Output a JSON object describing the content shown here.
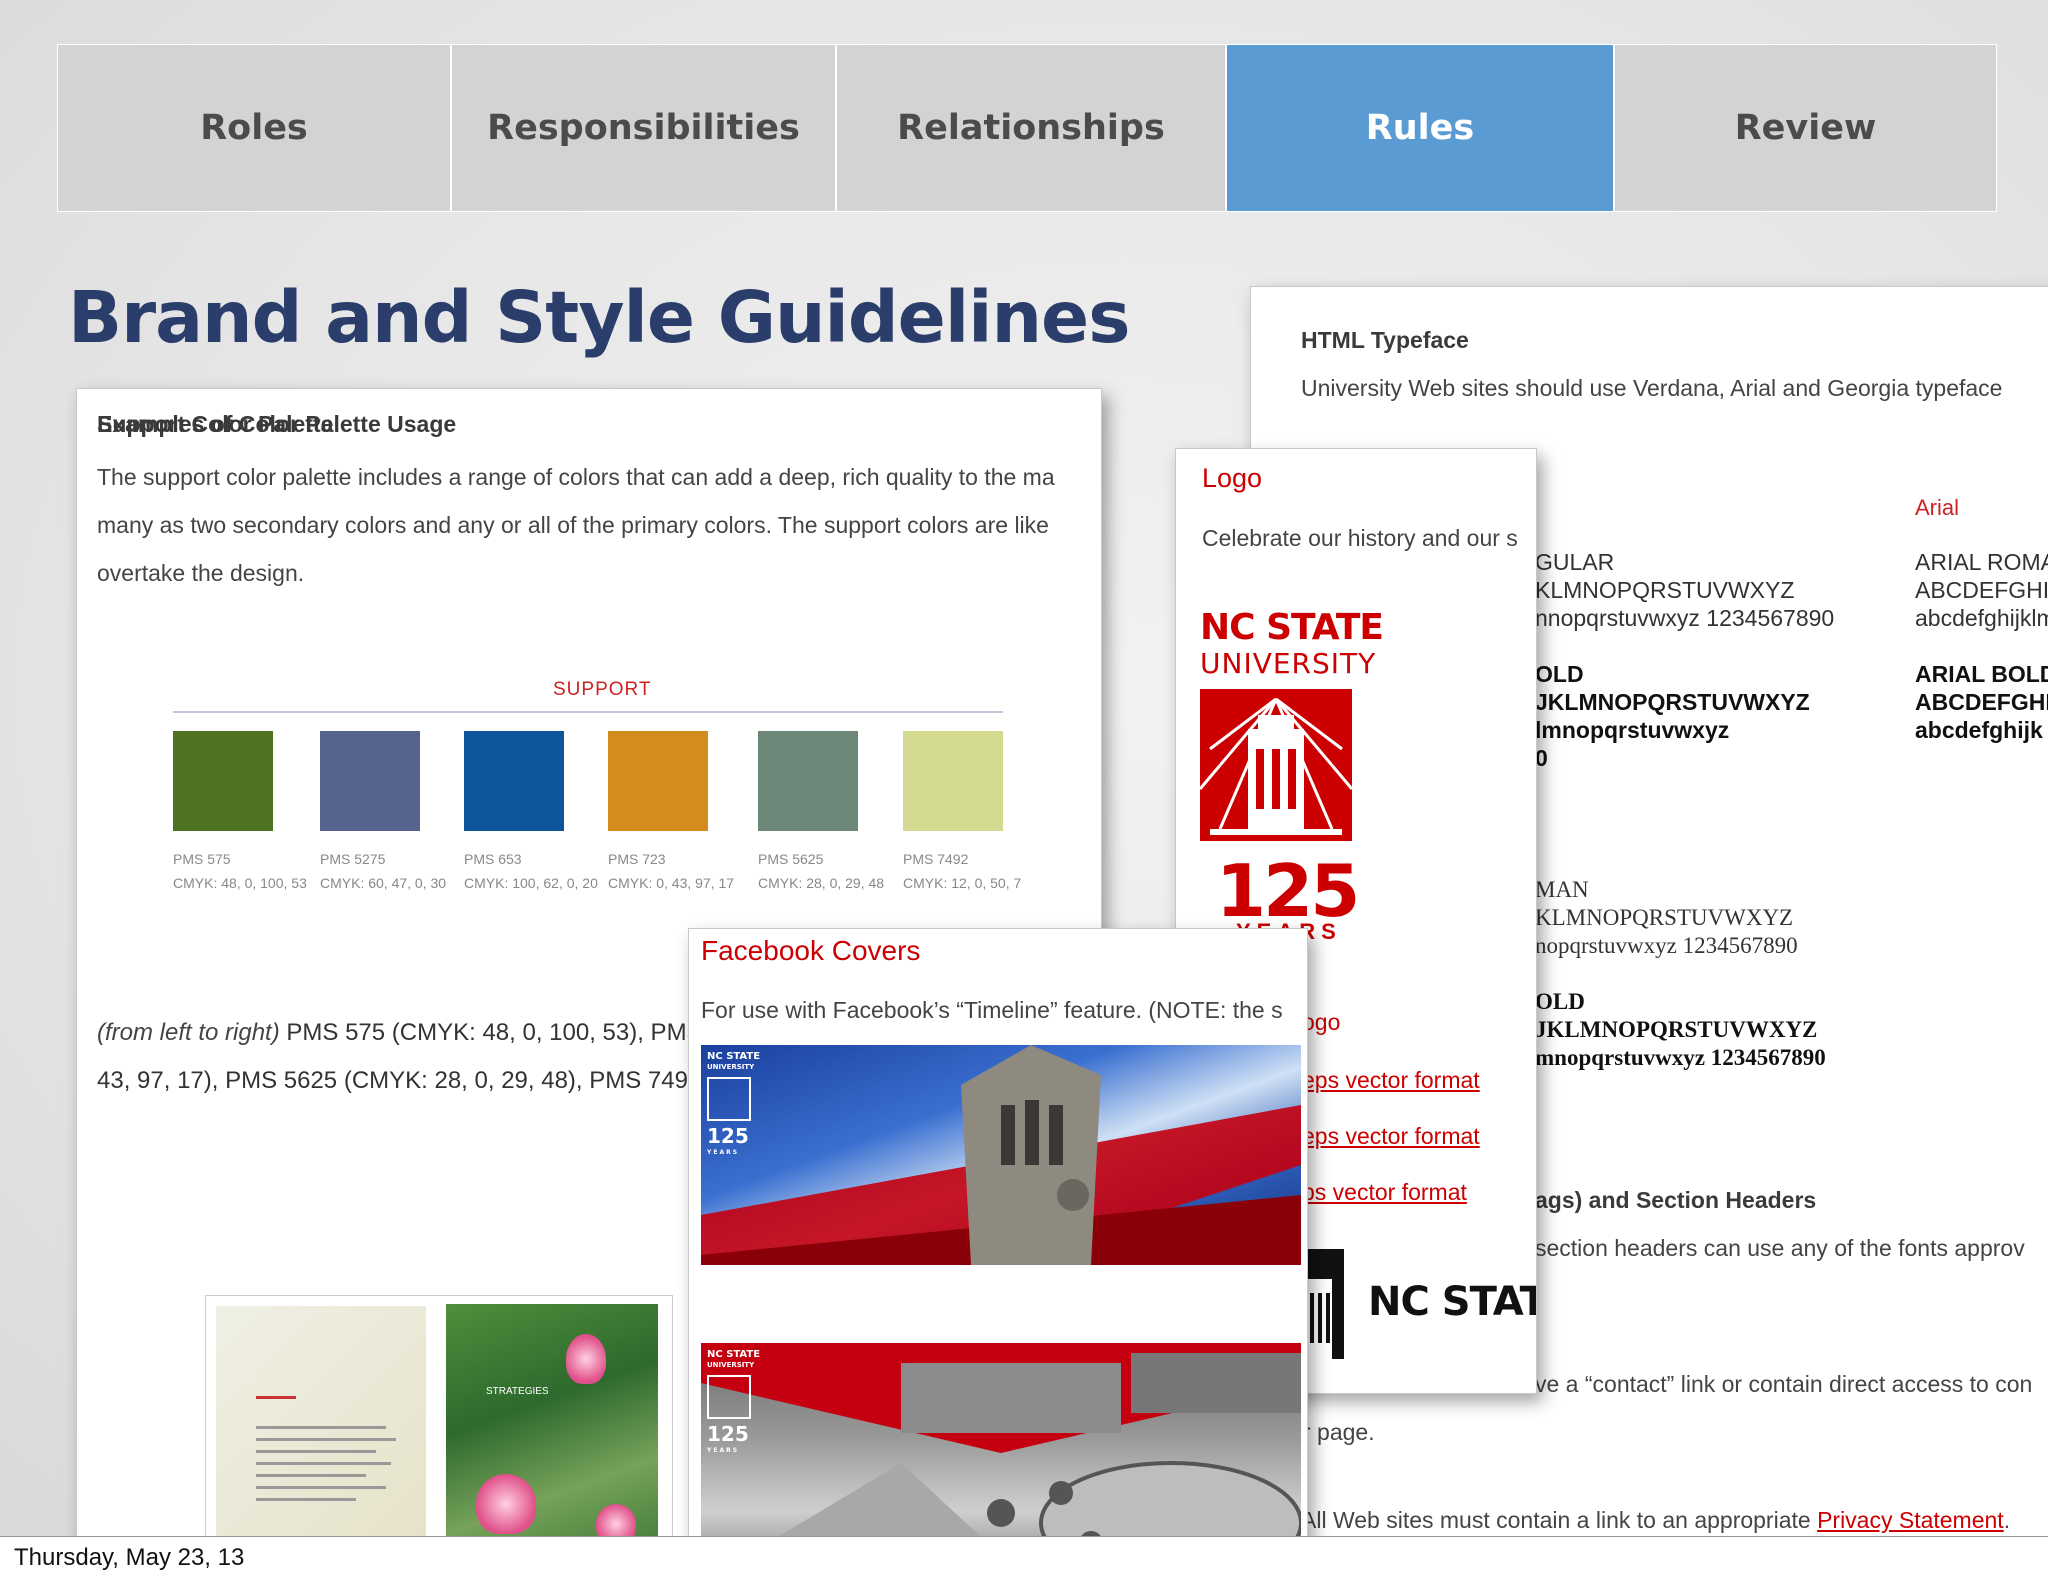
{
  "nav": {
    "tabs": [
      {
        "label": "Roles",
        "active": false
      },
      {
        "label": "Responsibilities",
        "active": false
      },
      {
        "label": "Relationships",
        "active": false
      },
      {
        "label": "Rules",
        "active": true
      },
      {
        "label": "Review",
        "active": false
      }
    ],
    "active_color": "#5a9bd3",
    "inactive_color": "#d3d3d3"
  },
  "page": {
    "title": "Brand and Style Guidelines",
    "footer_date": "Thursday, May 23, 13"
  },
  "palette_card": {
    "heading": "Support Color Palette",
    "lines": [
      "The support color palette includes a range of colors that can add a deep, rich quality to the ma",
      "many as two secondary colors and any or all of the primary colors. The support colors are like",
      "overtake the design."
    ],
    "support_label": "SUPPORT",
    "swatches": [
      {
        "name": "PMS 575",
        "cmyk": "CMYK: 48, 0, 100, 53",
        "color": "#4f7321"
      },
      {
        "name": "PMS 5275",
        "cmyk": "CMYK: 60, 47, 0, 30",
        "color": "#56638f"
      },
      {
        "name": "PMS 653",
        "cmyk": "CMYK: 100, 62, 0, 20",
        "color": "#0d5699"
      },
      {
        "name": "PMS 723",
        "cmyk": "CMYK: 0, 43, 97, 17",
        "color": "#d48c1f"
      },
      {
        "name": "PMS 5625",
        "cmyk": "CMYK: 28, 0, 29, 48",
        "color": "#6d8879"
      },
      {
        "name": "PMS 7492",
        "cmyk": "CMYK: 12, 0, 50, 7",
        "color": "#d3da8f"
      }
    ],
    "desc_italic": "(from left to right)",
    "desc_line1": " PMS 575 (CMYK: 48, 0, 100, 53), PMS",
    "desc_line2": "43, 97, 17), PMS 5625 (CMYK: 28, 0, 29, 48), PMS 749",
    "examples_heading": "Examples of Color Palette Usage",
    "example_headline": "STRATEGIES"
  },
  "type_card": {
    "heading": "HTML Typeface",
    "intro": "University Web sites should use Verdana, Arial and Georgia typeface",
    "arial_label": "Arial",
    "verdana_regular": [
      "GULAR",
      "KLMNOPQRSTUVWXYZ",
      "nnopqrstuvwxyz 1234567890"
    ],
    "verdana_bold": [
      "OLD",
      "JKLMNOPQRSTUVWXYZ",
      "lmnopqrstuvwxyz",
      "0"
    ],
    "arial_regular": [
      "ARIAL ROMA",
      "ABCDEFGHI",
      "abcdefghijklm"
    ],
    "arial_bold": [
      "ARIAL BOLD",
      "ABCDEFGHI",
      "abcdefghijk"
    ],
    "georgia_regular": [
      "MAN",
      "KLMNOPQRSTUVWXYZ",
      "nopqrstuvwxyz 1234567890"
    ],
    "georgia_bold": [
      "OLD",
      "JKLMNOPQRSTUVWXYZ",
      "mnopqrstuvwxyz 1234567890"
    ],
    "section_heading": "ags) and Section Headers",
    "section_text": "section headers can use any of the fonts approv",
    "contact_text": "ve a “contact” link or contain direct access to con",
    "page_text": "r page.",
    "privacy_prefix": "All Web sites must contain a link to an appropriate ",
    "privacy_link": "Privacy Statement",
    "privacy_suffix": "."
  },
  "logo_card": {
    "title": "Logo",
    "intro": "Celebrate our history and our s",
    "ncs_word": "NC STATE",
    "ncs_univ": "UNIVERSITY",
    "ncs_125": "125",
    "ncs_years": "YEARS",
    "link_head": "ogo",
    "links": [
      "eps vector format",
      "eps vector format",
      "ps vector format"
    ],
    "bottom_word": "NC STATE"
  },
  "fb_card": {
    "title": "Facebook Covers",
    "intro": "For use with Facebook’s “Timeline” feature. (NOTE: the s",
    "logo_small": "NC STATE",
    "logo_univ": "UNIVERSITY",
    "logo_num": "125",
    "logo_years": "YEARS"
  }
}
